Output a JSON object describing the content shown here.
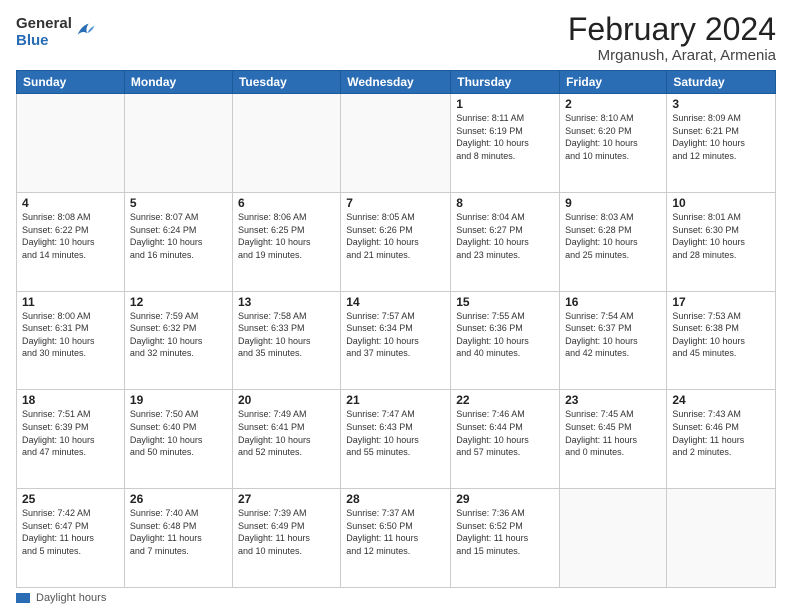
{
  "logo": {
    "general": "General",
    "blue": "Blue"
  },
  "header": {
    "month": "February 2024",
    "location": "Mrganush, Ararat, Armenia"
  },
  "weekdays": [
    "Sunday",
    "Monday",
    "Tuesday",
    "Wednesday",
    "Thursday",
    "Friday",
    "Saturday"
  ],
  "footer": {
    "legend_label": "Daylight hours"
  },
  "weeks": [
    [
      {
        "day": "",
        "info": ""
      },
      {
        "day": "",
        "info": ""
      },
      {
        "day": "",
        "info": ""
      },
      {
        "day": "",
        "info": ""
      },
      {
        "day": "1",
        "info": "Sunrise: 8:11 AM\nSunset: 6:19 PM\nDaylight: 10 hours\nand 8 minutes."
      },
      {
        "day": "2",
        "info": "Sunrise: 8:10 AM\nSunset: 6:20 PM\nDaylight: 10 hours\nand 10 minutes."
      },
      {
        "day": "3",
        "info": "Sunrise: 8:09 AM\nSunset: 6:21 PM\nDaylight: 10 hours\nand 12 minutes."
      }
    ],
    [
      {
        "day": "4",
        "info": "Sunrise: 8:08 AM\nSunset: 6:22 PM\nDaylight: 10 hours\nand 14 minutes."
      },
      {
        "day": "5",
        "info": "Sunrise: 8:07 AM\nSunset: 6:24 PM\nDaylight: 10 hours\nand 16 minutes."
      },
      {
        "day": "6",
        "info": "Sunrise: 8:06 AM\nSunset: 6:25 PM\nDaylight: 10 hours\nand 19 minutes."
      },
      {
        "day": "7",
        "info": "Sunrise: 8:05 AM\nSunset: 6:26 PM\nDaylight: 10 hours\nand 21 minutes."
      },
      {
        "day": "8",
        "info": "Sunrise: 8:04 AM\nSunset: 6:27 PM\nDaylight: 10 hours\nand 23 minutes."
      },
      {
        "day": "9",
        "info": "Sunrise: 8:03 AM\nSunset: 6:28 PM\nDaylight: 10 hours\nand 25 minutes."
      },
      {
        "day": "10",
        "info": "Sunrise: 8:01 AM\nSunset: 6:30 PM\nDaylight: 10 hours\nand 28 minutes."
      }
    ],
    [
      {
        "day": "11",
        "info": "Sunrise: 8:00 AM\nSunset: 6:31 PM\nDaylight: 10 hours\nand 30 minutes."
      },
      {
        "day": "12",
        "info": "Sunrise: 7:59 AM\nSunset: 6:32 PM\nDaylight: 10 hours\nand 32 minutes."
      },
      {
        "day": "13",
        "info": "Sunrise: 7:58 AM\nSunset: 6:33 PM\nDaylight: 10 hours\nand 35 minutes."
      },
      {
        "day": "14",
        "info": "Sunrise: 7:57 AM\nSunset: 6:34 PM\nDaylight: 10 hours\nand 37 minutes."
      },
      {
        "day": "15",
        "info": "Sunrise: 7:55 AM\nSunset: 6:36 PM\nDaylight: 10 hours\nand 40 minutes."
      },
      {
        "day": "16",
        "info": "Sunrise: 7:54 AM\nSunset: 6:37 PM\nDaylight: 10 hours\nand 42 minutes."
      },
      {
        "day": "17",
        "info": "Sunrise: 7:53 AM\nSunset: 6:38 PM\nDaylight: 10 hours\nand 45 minutes."
      }
    ],
    [
      {
        "day": "18",
        "info": "Sunrise: 7:51 AM\nSunset: 6:39 PM\nDaylight: 10 hours\nand 47 minutes."
      },
      {
        "day": "19",
        "info": "Sunrise: 7:50 AM\nSunset: 6:40 PM\nDaylight: 10 hours\nand 50 minutes."
      },
      {
        "day": "20",
        "info": "Sunrise: 7:49 AM\nSunset: 6:41 PM\nDaylight: 10 hours\nand 52 minutes."
      },
      {
        "day": "21",
        "info": "Sunrise: 7:47 AM\nSunset: 6:43 PM\nDaylight: 10 hours\nand 55 minutes."
      },
      {
        "day": "22",
        "info": "Sunrise: 7:46 AM\nSunset: 6:44 PM\nDaylight: 10 hours\nand 57 minutes."
      },
      {
        "day": "23",
        "info": "Sunrise: 7:45 AM\nSunset: 6:45 PM\nDaylight: 11 hours\nand 0 minutes."
      },
      {
        "day": "24",
        "info": "Sunrise: 7:43 AM\nSunset: 6:46 PM\nDaylight: 11 hours\nand 2 minutes."
      }
    ],
    [
      {
        "day": "25",
        "info": "Sunrise: 7:42 AM\nSunset: 6:47 PM\nDaylight: 11 hours\nand 5 minutes."
      },
      {
        "day": "26",
        "info": "Sunrise: 7:40 AM\nSunset: 6:48 PM\nDaylight: 11 hours\nand 7 minutes."
      },
      {
        "day": "27",
        "info": "Sunrise: 7:39 AM\nSunset: 6:49 PM\nDaylight: 11 hours\nand 10 minutes."
      },
      {
        "day": "28",
        "info": "Sunrise: 7:37 AM\nSunset: 6:50 PM\nDaylight: 11 hours\nand 12 minutes."
      },
      {
        "day": "29",
        "info": "Sunrise: 7:36 AM\nSunset: 6:52 PM\nDaylight: 11 hours\nand 15 minutes."
      },
      {
        "day": "",
        "info": ""
      },
      {
        "day": "",
        "info": ""
      }
    ]
  ]
}
